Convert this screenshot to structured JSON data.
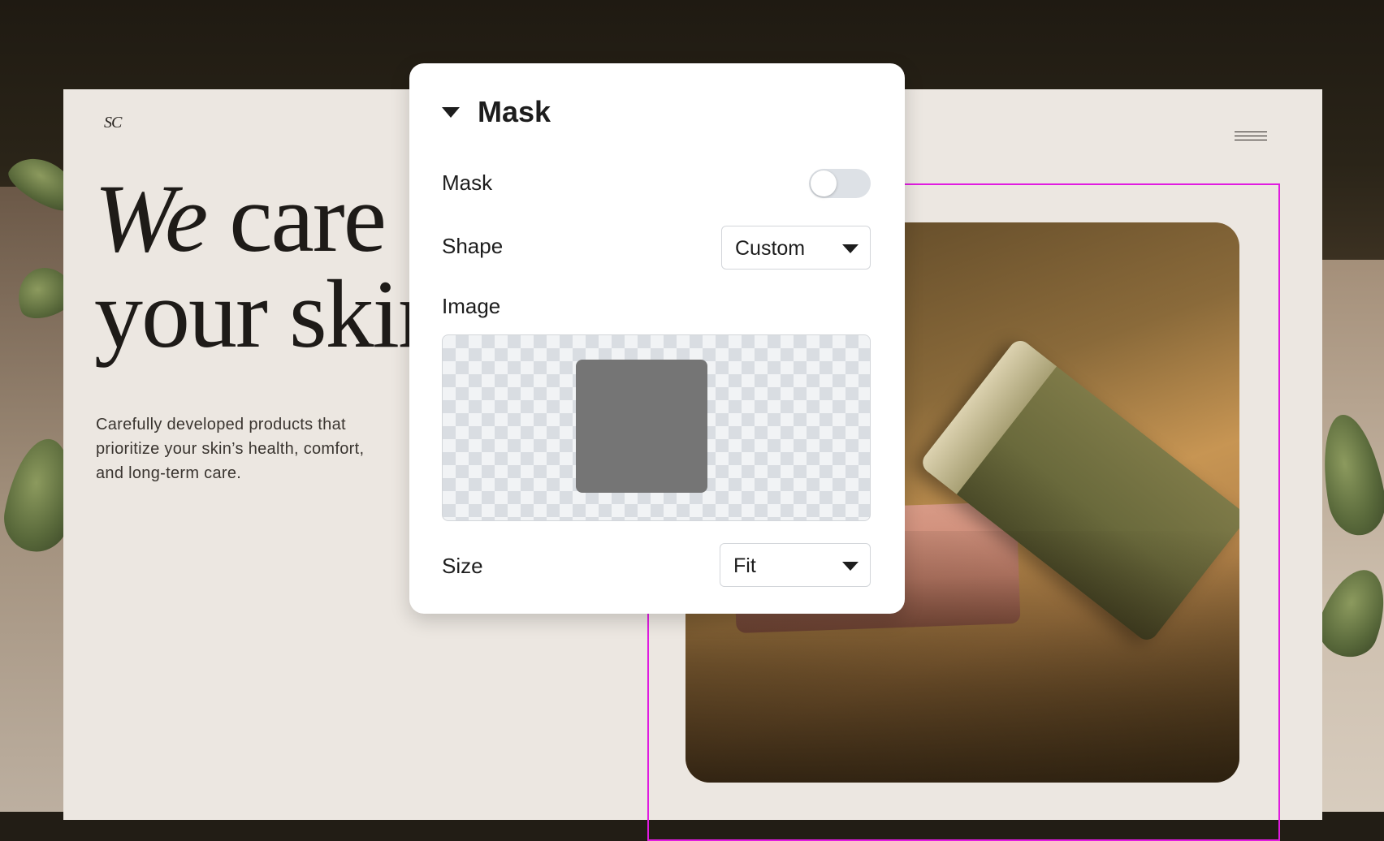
{
  "site": {
    "logo": "SC",
    "headline_italic": "We",
    "headline_rest_line1": " care",
    "headline_line2": "your skin",
    "description": "Carefully developed products that prioritize your skin’s health, comfort, and long-term care."
  },
  "colors": {
    "selection_outline": "#e01ce0",
    "page_background": "#ece7e1",
    "mask_swatch": "#757575"
  },
  "mask_panel": {
    "title": "Mask",
    "rows": {
      "mask_label": "Mask",
      "mask_toggle_on": false,
      "shape_label": "Shape",
      "shape_value": "Custom",
      "image_label": "Image",
      "size_label": "Size",
      "size_value": "Fit"
    }
  },
  "icons": {
    "menu": "hamburger-menu-icon",
    "collapse": "caret-down-icon",
    "dropdown": "dropdown-arrow-icon"
  }
}
